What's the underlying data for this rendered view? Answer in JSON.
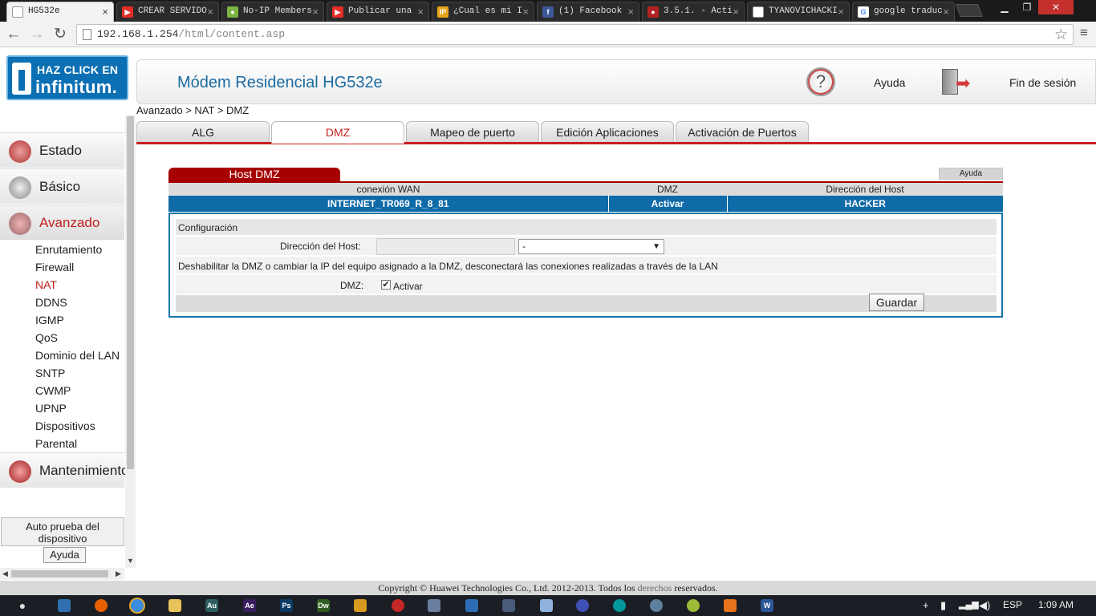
{
  "browser": {
    "tabs": [
      {
        "title": "HG532e",
        "active": true,
        "icon": "page-icon",
        "color": "#ffffff"
      },
      {
        "title": "CREAR SERVIDO",
        "icon": "youtube-icon",
        "color": "#e52d27"
      },
      {
        "title": "No-IP Members",
        "icon": "noip-icon",
        "color": "#7cb342"
      },
      {
        "title": "Publicar una",
        "icon": "youtube-icon",
        "color": "#e52d27"
      },
      {
        "title": "¿Cual es mi I",
        "icon": "ip-icon",
        "color": "#e8a317"
      },
      {
        "title": "(1) Facebook",
        "icon": "facebook-icon",
        "color": "#3b5998"
      },
      {
        "title": "3.5.1. - Acti",
        "icon": "generic-icon",
        "color": "#b22222"
      },
      {
        "title": "TYANOVICHACKI",
        "icon": "page-icon",
        "color": "#ffffff"
      },
      {
        "title": "google traduc",
        "icon": "google-icon",
        "color": "#4285f4"
      }
    ],
    "url_host": "192.168.1.254",
    "url_path": "/html/content.asp"
  },
  "sidebar": {
    "sections": [
      {
        "label": "Estado",
        "icon": "status-icon"
      },
      {
        "label": "Básico",
        "icon": "basic-gear-icon"
      },
      {
        "label": "Avanzado",
        "icon": "advanced-icon",
        "active": true
      },
      {
        "label": "Mantenimiento",
        "icon": "maintenance-icon"
      }
    ],
    "sub_items": [
      "Enrutamiento",
      "Firewall",
      "NAT",
      "DDNS",
      "IGMP",
      "QoS",
      "Dominio del LAN",
      "SNTP",
      "CWMP",
      "UPNP",
      "Dispositivos",
      "Parental"
    ],
    "active_sub": "NAT",
    "self_test": "Auto prueba del dispositivo",
    "help": "Ayuda"
  },
  "logo": {
    "line1": "HAZ CLICK EN",
    "line2": "infinitum."
  },
  "header": {
    "model": "Módem Residencial HG532e",
    "help": "Ayuda",
    "logout": "Fin de sesión"
  },
  "breadcrumb": "Avanzado > NAT > DMZ",
  "tabs": [
    "ALG",
    "DMZ",
    "Mapeo de puerto",
    "Edición Aplicaciones",
    "Activación de Puertos"
  ],
  "active_tab": "DMZ",
  "dmz": {
    "title": "Host DMZ",
    "help": "Ayuda",
    "table": {
      "headers": [
        "conexión WAN",
        "DMZ",
        "Dirección del Host"
      ],
      "row": [
        "INTERNET_TR069_R_8_81",
        "Activar",
        "HACKER"
      ]
    },
    "config": {
      "title": "Configuración",
      "host_label": "Dirección del Host:",
      "host_ip_value": "",
      "host_select_value": "-",
      "warning": "Deshabilitar la DMZ o cambiar la IP del equipo asignado a la DMZ, desconectará las conexiones realizadas a través de la LAN",
      "dmz_label": "DMZ:",
      "dmz_checked": true,
      "dmz_check_label": "Activar",
      "save": "Guardar"
    }
  },
  "footer": {
    "before": "Copyright © Huawei Technologies Co., Ltd. 2012-2013. Todos los ",
    "link": "derechos",
    "after": " reservados."
  },
  "taskbar": {
    "lang": "ESP",
    "time": "1:09 AM"
  },
  "colors": {
    "accent_red": "#c71f1f",
    "dmz_title_red": "#a60000",
    "table_blue": "#0f6aa8",
    "model_blue": "#1a6ba0"
  }
}
